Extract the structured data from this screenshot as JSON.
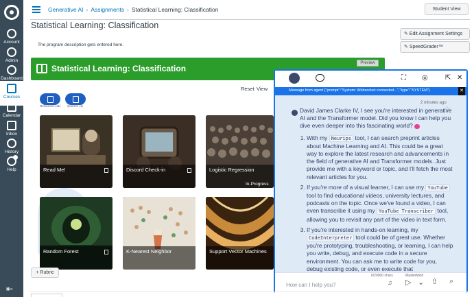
{
  "nav": {
    "account": "Account",
    "admin": "Admin",
    "dashboard": "Dashboard",
    "courses": "Courses",
    "calendar": "Calendar",
    "inbox": "Inbox",
    "history": "History",
    "help": "Help"
  },
  "breadcrumb": {
    "course": "Generative AI",
    "section": "Assignments",
    "current": "Statistical Learning: Classification"
  },
  "header": {
    "student_view": "Student View"
  },
  "page": {
    "title": "Statistical Learning: Classification",
    "description": "The program description gets entered here.",
    "edit_settings": "Edit Assignment Settings",
    "speedgrader": "SpeedGrader™"
  },
  "banner": {
    "title": "Statistical Learning: Classification",
    "preview": "Preview"
  },
  "controls": {
    "reset": "Reset",
    "view": "View"
  },
  "chips": [
    {
      "label": "Resources (11)"
    },
    {
      "label": "Quizzes (1)"
    }
  ],
  "cards": [
    {
      "title": "Read Me!",
      "status": ""
    },
    {
      "title": "Discord Check-in",
      "status": ""
    },
    {
      "title": "Logistic Regression",
      "status": "In-Progress"
    },
    {
      "title": "Random Forest",
      "status": ""
    },
    {
      "title": "K-Nearest Neighbor",
      "status": ""
    },
    {
      "title": "Support Vector Machines",
      "status": ""
    }
  ],
  "rubric": {
    "label": "+ Rubric"
  },
  "chat": {
    "system_message": "Message from agent {\"prompt\":\"System: Websocket connected...\",\"type\":\"SYSTEM\"}",
    "time": "2 minutes ago",
    "intro": "David James Clarke IV, I see you're interested in generative AI and the Transformer model. Did you know I can help you dive even deeper into this fascinating world?",
    "item1_a": "With my",
    "item1_tool": "Neurips",
    "item1_b": "tool, I can search preprint articles about Machine Learning and AI. This could be a great way to explore the latest research and advancements in the field of generative AI and Transformer models. Just provide me with a keyword or topic, and I'll fetch the most relevant articles for you.",
    "item2_a": "If you're more of a visual learner, I can use my",
    "item2_tool1": "YouTube",
    "item2_b": "tool to find educational videos, university lectures, and podcasts on the topic. Once we've found a video, I can even transcribe it using my",
    "item2_tool2": "YouTube Transcriber",
    "item2_c": "tool, allowing you to revisit any part of the video in text form.",
    "item3_a": "If you're interested in hands-on learning, my",
    "item3_tool": "CodeInterpreter",
    "item3_b": "tool could be of great use. Whether you're prototyping, troubleshooting, or learning, I can help you write, debug, and execute code in a secure environment. You can ask me to write code for you, debug existing code, or even execute that",
    "chars": "0/20000 chars",
    "model": "MasterMind",
    "placeholder": "How can I help you?"
  }
}
